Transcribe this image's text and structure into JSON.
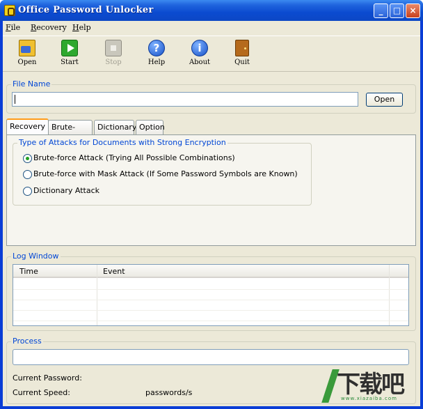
{
  "window": {
    "title": "Office Password Unlocker",
    "controls": {
      "minimize": "_",
      "maximize": "□",
      "close": "×"
    }
  },
  "menu": [
    "File",
    "Recovery",
    "Help"
  ],
  "toolbar": [
    {
      "label": "Open",
      "icon": "open-folder-icon",
      "enabled": true
    },
    {
      "label": "Start",
      "icon": "play-icon",
      "enabled": true
    },
    {
      "label": "Stop",
      "icon": "stop-icon",
      "enabled": false
    },
    {
      "label": "Help",
      "icon": "help-icon",
      "glyph": "?",
      "enabled": true
    },
    {
      "label": "About",
      "icon": "info-icon",
      "glyph": "i",
      "enabled": true
    },
    {
      "label": "Quit",
      "icon": "door-icon",
      "enabled": true
    }
  ],
  "file_name": {
    "group_title": "File Name",
    "value": "",
    "open_button": "Open"
  },
  "tabs": {
    "items": [
      "Recovery",
      "Brute-force",
      "Dictionary",
      "Option"
    ],
    "active": "Recovery"
  },
  "attack_type": {
    "group_title": "Type of Attacks for Documents with Strong Encryption",
    "options": [
      {
        "label": "Brute-force Attack (Trying All Possible Combinations)",
        "checked": true
      },
      {
        "label": "Brute-force with Mask Attack (If Some Password Symbols are Known)",
        "checked": false
      },
      {
        "label": "Dictionary Attack",
        "checked": false
      }
    ]
  },
  "log": {
    "group_title": "Log Window",
    "columns": [
      "Time",
      "Event"
    ],
    "rows": []
  },
  "process": {
    "group_title": "Process",
    "progress": 0,
    "current_password_label": "Current Password:",
    "current_password_value": "",
    "current_speed_label": "Current Speed:",
    "current_speed_value": "passwords/s"
  },
  "watermark": {
    "text": "下载吧",
    "sub": "www.xiazaiba.com"
  },
  "colors": {
    "titlebar": "#0b4bd0",
    "client_bg": "#ece9d8",
    "group_title": "#0046d5",
    "tab_accent": "#ff9c1a",
    "radio_dot": "#21a121"
  }
}
